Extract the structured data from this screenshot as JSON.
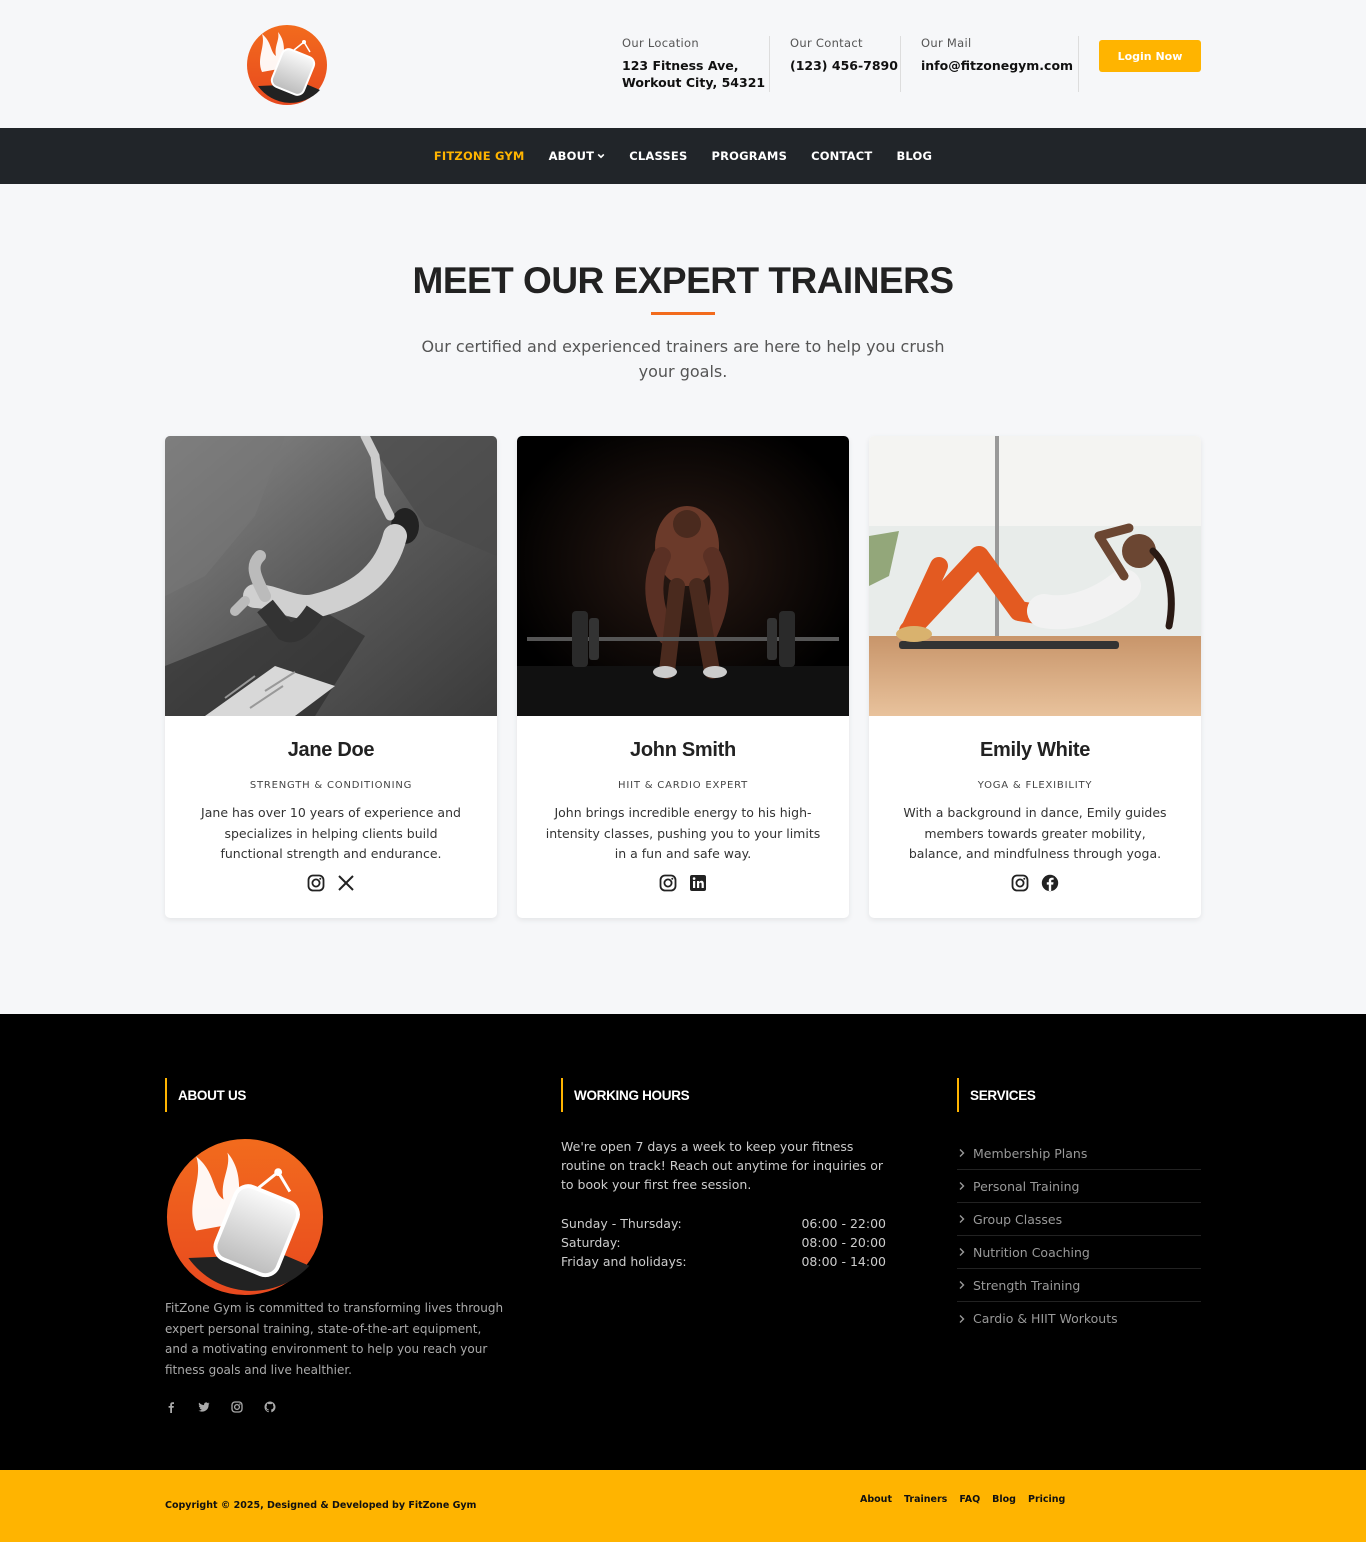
{
  "header": {
    "location_label": "Our Location",
    "location_line1": "123 Fitness Ave,",
    "location_line2": "Workout City, 54321",
    "contact_label": "Our Contact",
    "contact_value": "(123) 456-7890",
    "mail_label": "Our Mail",
    "mail_value": "info@fitzonegym.com",
    "login_label": "Login Now"
  },
  "nav": {
    "items": [
      {
        "label": "FITZONE GYM"
      },
      {
        "label": "ABOUT"
      },
      {
        "label": "CLASSES"
      },
      {
        "label": "PROGRAMS"
      },
      {
        "label": "CONTACT"
      },
      {
        "label": "BLOG"
      }
    ]
  },
  "section": {
    "title": "MEET OUR EXPERT TRAINERS",
    "subtitle": "Our certified and experienced trainers are here to help you crush your goals."
  },
  "trainers": [
    {
      "name": "Jane Doe",
      "role": "STRENGTH & CONDITIONING",
      "desc": "Jane has over 10 years of experience and specializes in helping clients build functional strength and endurance.",
      "socials": [
        "instagram-icon",
        "x-icon"
      ]
    },
    {
      "name": "John Smith",
      "role": "HIIT & CARDIO EXPERT",
      "desc": "John brings incredible energy to his high-intensity classes, pushing you to your limits in a fun and safe way.",
      "socials": [
        "instagram-icon",
        "linkedin-icon"
      ]
    },
    {
      "name": "Emily White",
      "role": "YOGA & FLEXIBILITY",
      "desc": "With a background in dance, Emily guides members towards greater mobility, balance, and mindfulness through yoga.",
      "socials": [
        "instagram-icon",
        "facebook-icon"
      ]
    }
  ],
  "footer": {
    "about_title": "ABOUT US",
    "about_text": "FitZone Gym is committed to transforming lives through expert personal training, state-of-the-art equipment, and a motivating environment to help you reach your fitness goals and live healthier.",
    "hours_title": "WORKING HOURS",
    "hours_text": "We're open 7 days a week to keep your fitness routine on track! Reach out anytime for inquiries or to book your first free session.",
    "hours": [
      {
        "day": "Sunday - Thursday:",
        "time": "06:00 - 22:00"
      },
      {
        "day": "Saturday:",
        "time": "08:00 - 20:00"
      },
      {
        "day": "Friday and holidays:",
        "time": "08:00 - 14:00"
      }
    ],
    "services_title": "SERVICES",
    "services": [
      "Membership Plans",
      "Personal Training",
      "Group Classes",
      "Nutrition Coaching",
      "Strength Training",
      "Cardio & HIIT Workouts"
    ]
  },
  "bottom": {
    "copyright": "Copyright © 2025, Designed & Developed by FitZone Gym",
    "links": [
      "About",
      "Trainers",
      "FAQ",
      "Blog",
      "Pricing"
    ]
  },
  "colors": {
    "accent": "#ffb400",
    "brand_orange": "#f26b1d",
    "nav_bg": "#212529"
  }
}
